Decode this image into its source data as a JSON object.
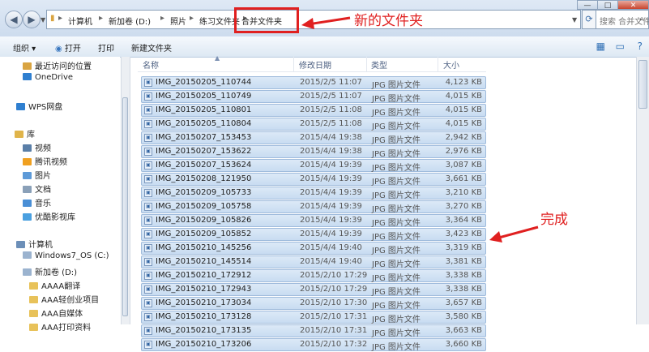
{
  "window_controls": [
    "—",
    "□",
    "✕"
  ],
  "address": {
    "crumbs": [
      "计算机",
      "新加卷 (D:)",
      "照片",
      "练习文件夹",
      "合并文件夹"
    ]
  },
  "search": {
    "placeholder": "搜索 合并文件夹"
  },
  "toolbar": {
    "organize": "组织 ▾",
    "open": "打开",
    "print": "打印",
    "new_folder": "新建文件夹"
  },
  "nav": {
    "items": [
      {
        "label": "最近访问的位置",
        "color": "#d9a441"
      },
      {
        "label": "OneDrive",
        "color": "#2f7fd0"
      },
      {
        "label": "WPS网盘",
        "color": "#2f7fd0"
      },
      {
        "label": "库",
        "color": "#e0b44a"
      },
      {
        "label": "视频",
        "color": "#5a7fa8"
      },
      {
        "label": "腾讯视频",
        "color": "#f0a020"
      },
      {
        "label": "图片",
        "color": "#5d9ad8"
      },
      {
        "label": "文档",
        "color": "#8aa0b8"
      },
      {
        "label": "音乐",
        "color": "#4a8fd6"
      },
      {
        "label": "优酷影视库",
        "color": "#4aa0e0"
      },
      {
        "label": "计算机",
        "color": "#6c8fb8"
      },
      {
        "label": "Windows7_OS (C:)",
        "color": "#9bb3cf"
      },
      {
        "label": "新加卷 (D:)",
        "color": "#9bb3cf"
      },
      {
        "label": "AAAA翻译",
        "color": "#e8c25a"
      },
      {
        "label": "AAA轻创业项目",
        "color": "#e8c25a"
      },
      {
        "label": "AAA自媒体",
        "color": "#e8c25a"
      },
      {
        "label": "AAA打印资料",
        "color": "#e8c25a"
      }
    ]
  },
  "columns": {
    "name": "名称",
    "date": "修改日期",
    "type": "类型",
    "size": "大小"
  },
  "files": [
    {
      "name": "IMG_20150205_110744",
      "date": "2015/2/5 11:07",
      "type": "JPG 图片文件",
      "size": "4,123 KB"
    },
    {
      "name": "IMG_20150205_110749",
      "date": "2015/2/5 11:07",
      "type": "JPG 图片文件",
      "size": "4,015 KB"
    },
    {
      "name": "IMG_20150205_110801",
      "date": "2015/2/5 11:08",
      "type": "JPG 图片文件",
      "size": "4,015 KB"
    },
    {
      "name": "IMG_20150205_110804",
      "date": "2015/2/5 11:08",
      "type": "JPG 图片文件",
      "size": "4,015 KB"
    },
    {
      "name": "IMG_20150207_153453",
      "date": "2015/4/4 19:38",
      "type": "JPG 图片文件",
      "size": "2,942 KB"
    },
    {
      "name": "IMG_20150207_153622",
      "date": "2015/4/4 19:38",
      "type": "JPG 图片文件",
      "size": "2,976 KB"
    },
    {
      "name": "IMG_20150207_153624",
      "date": "2015/4/4 19:39",
      "type": "JPG 图片文件",
      "size": "3,087 KB"
    },
    {
      "name": "IMG_20150208_121950",
      "date": "2015/4/4 19:39",
      "type": "JPG 图片文件",
      "size": "3,661 KB"
    },
    {
      "name": "IMG_20150209_105733",
      "date": "2015/4/4 19:39",
      "type": "JPG 图片文件",
      "size": "3,210 KB"
    },
    {
      "name": "IMG_20150209_105758",
      "date": "2015/4/4 19:39",
      "type": "JPG 图片文件",
      "size": "3,270 KB"
    },
    {
      "name": "IMG_20150209_105826",
      "date": "2015/4/4 19:39",
      "type": "JPG 图片文件",
      "size": "3,364 KB"
    },
    {
      "name": "IMG_20150209_105852",
      "date": "2015/4/4 19:39",
      "type": "JPG 图片文件",
      "size": "3,423 KB"
    },
    {
      "name": "IMG_20150210_145256",
      "date": "2015/4/4 19:40",
      "type": "JPG 图片文件",
      "size": "3,319 KB"
    },
    {
      "name": "IMG_20150210_145514",
      "date": "2015/4/4 19:40",
      "type": "JPG 图片文件",
      "size": "3,381 KB"
    },
    {
      "name": "IMG_20150210_172912",
      "date": "2015/2/10 17:29",
      "type": "JPG 图片文件",
      "size": "3,338 KB"
    },
    {
      "name": "IMG_20150210_172943",
      "date": "2015/2/10 17:29",
      "type": "JPG 图片文件",
      "size": "3,338 KB"
    },
    {
      "name": "IMG_20150210_173034",
      "date": "2015/2/10 17:30",
      "type": "JPG 图片文件",
      "size": "3,657 KB"
    },
    {
      "name": "IMG_20150210_173128",
      "date": "2015/2/10 17:31",
      "type": "JPG 图片文件",
      "size": "3,580 KB"
    },
    {
      "name": "IMG_20150210_173135",
      "date": "2015/2/10 17:31",
      "type": "JPG 图片文件",
      "size": "3,663 KB"
    },
    {
      "name": "IMG_20150210_173206",
      "date": "2015/2/10 17:32",
      "type": "JPG 图片文件",
      "size": "3,660 KB"
    }
  ],
  "annotations": {
    "new_folder": "新的文件夹",
    "done": "完成",
    "color": "#e02020"
  }
}
